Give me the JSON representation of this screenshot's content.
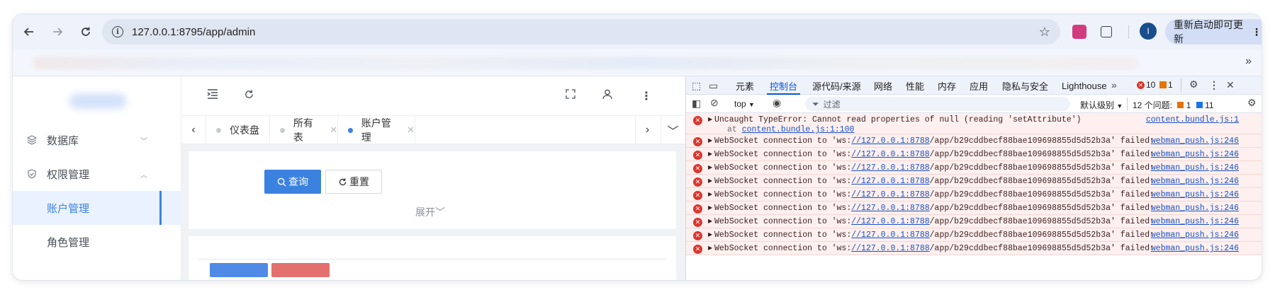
{
  "browser": {
    "url": "127.0.0.1:8795/app/admin",
    "profile_initial": "I",
    "restart_label": "重新启动即可更新",
    "more_bookmarks": "»"
  },
  "sidebar": {
    "items": [
      {
        "label": "数据库",
        "icon": "layers-icon"
      },
      {
        "label": "权限管理",
        "icon": "shield-icon"
      },
      {
        "label": "账户管理",
        "active": true
      },
      {
        "label": "角色管理"
      }
    ]
  },
  "tabs": [
    {
      "label": "仪表盘"
    },
    {
      "label": "所有表"
    },
    {
      "label": "账户管理",
      "active": true
    }
  ],
  "search_form": {
    "query_label": "查询",
    "reset_label": "重置",
    "expand_label": "展开"
  },
  "devtools": {
    "tabs": [
      "元素",
      "控制台",
      "源代码/来源",
      "网络",
      "性能",
      "内存",
      "应用",
      "隐私与安全",
      "Lighthouse"
    ],
    "active_tab": "控制台",
    "error_count": "10",
    "warning_count": "1",
    "context": "top",
    "filter_placeholder": "过滤",
    "level": "默认级别",
    "issues_label": "12 个问题:",
    "issues_warn": "1",
    "issues_info": "11",
    "messages": [
      {
        "prefix": "Uncaught TypeError: Cannot read properties of null (reading 'setAttribute')",
        "sub_prefix": "at ",
        "sub_link": "content.bundle.js:1:100",
        "source": "content.bundle.js:1"
      },
      {
        "prefix": "WebSocket connection to 'ws:",
        "link": "//127.0.0.1:8788",
        "suffix": "/app/b29cddbecf88bae109698855d5d52b3a' failed:",
        "source": "webman_push.js:246"
      },
      {
        "prefix": "WebSocket connection to 'ws:",
        "link": "//127.0.0.1:8788",
        "suffix": "/app/b29cddbecf88bae109698855d5d52b3a' failed:",
        "source": "webman_push.js:246"
      },
      {
        "prefix": "WebSocket connection to 'ws:",
        "link": "//127.0.0.1:8788",
        "suffix": "/app/b29cddbecf88bae109698855d5d52b3a' failed:",
        "source": "webman_push.js:246"
      },
      {
        "prefix": "WebSocket connection to 'ws:",
        "link": "//127.0.0.1:8788",
        "suffix": "/app/b29cddbecf88bae109698855d5d52b3a' failed:",
        "source": "webman_push.js:246"
      },
      {
        "prefix": "WebSocket connection to 'ws:",
        "link": "//127.0.0.1:8788",
        "suffix": "/app/b29cddbecf88bae109698855d5d52b3a' failed:",
        "source": "webman_push.js:246"
      },
      {
        "prefix": "WebSocket connection to 'ws:",
        "link": "//127.0.0.1:8788",
        "suffix": "/app/b29cddbecf88bae109698855d5d52b3a' failed:",
        "source": "webman_push.js:246"
      },
      {
        "prefix": "WebSocket connection to 'ws:",
        "link": "//127.0.0.1:8788",
        "suffix": "/app/b29cddbecf88bae109698855d5d52b3a' failed:",
        "source": "webman_push.js:246"
      },
      {
        "prefix": "WebSocket connection to 'ws:",
        "link": "//127.0.0.1:8788",
        "suffix": "/app/b29cddbecf88bae109698855d5d52b3a' failed:",
        "source": "webman_push.js:246"
      },
      {
        "prefix": "WebSocket connection to 'ws:",
        "link": "//127.0.0.1:8788",
        "suffix": "/app/b29cddbecf88bae109698855d5d52b3a' failed:",
        "source": "webman_push.js:246"
      }
    ]
  },
  "colors": {
    "accent": "#3b82e0",
    "error": "#dc362e",
    "delete_button": "#e36f6f"
  }
}
